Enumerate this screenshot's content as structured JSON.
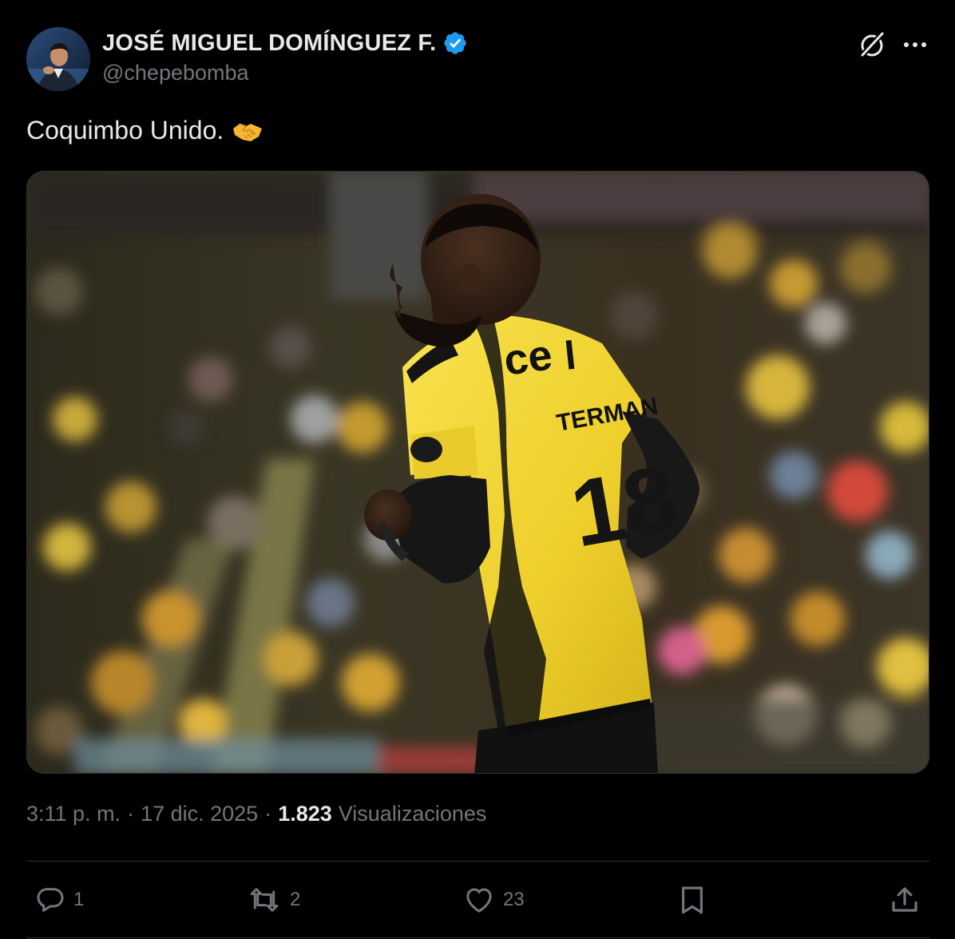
{
  "author": {
    "display_name": "JOSÉ MIGUEL DOMÍNGUEZ F.",
    "handle": "@chepebomba",
    "verified": true,
    "verified_color": "#1d9bf0"
  },
  "header_icons": {
    "grok": "grok-icon",
    "more": "more-icon"
  },
  "tweet": {
    "text": "Coquimbo Unido.",
    "emoji": "handshake-emoji"
  },
  "media": {
    "type": "photo",
    "jersey_number": "18"
  },
  "meta": {
    "time": "3:11 p. m.",
    "date": "17 dic. 2025",
    "separator": "·",
    "views_count": "1.823",
    "views_label": "Visualizaciones"
  },
  "actions": {
    "reply_count": "1",
    "retweet_count": "2",
    "like_count": "23"
  },
  "colors": {
    "background": "#000000",
    "text_primary": "#e7e9ea",
    "text_secondary": "#71767b",
    "divider": "#2f3336",
    "jersey_yellow": "#f2d335"
  }
}
